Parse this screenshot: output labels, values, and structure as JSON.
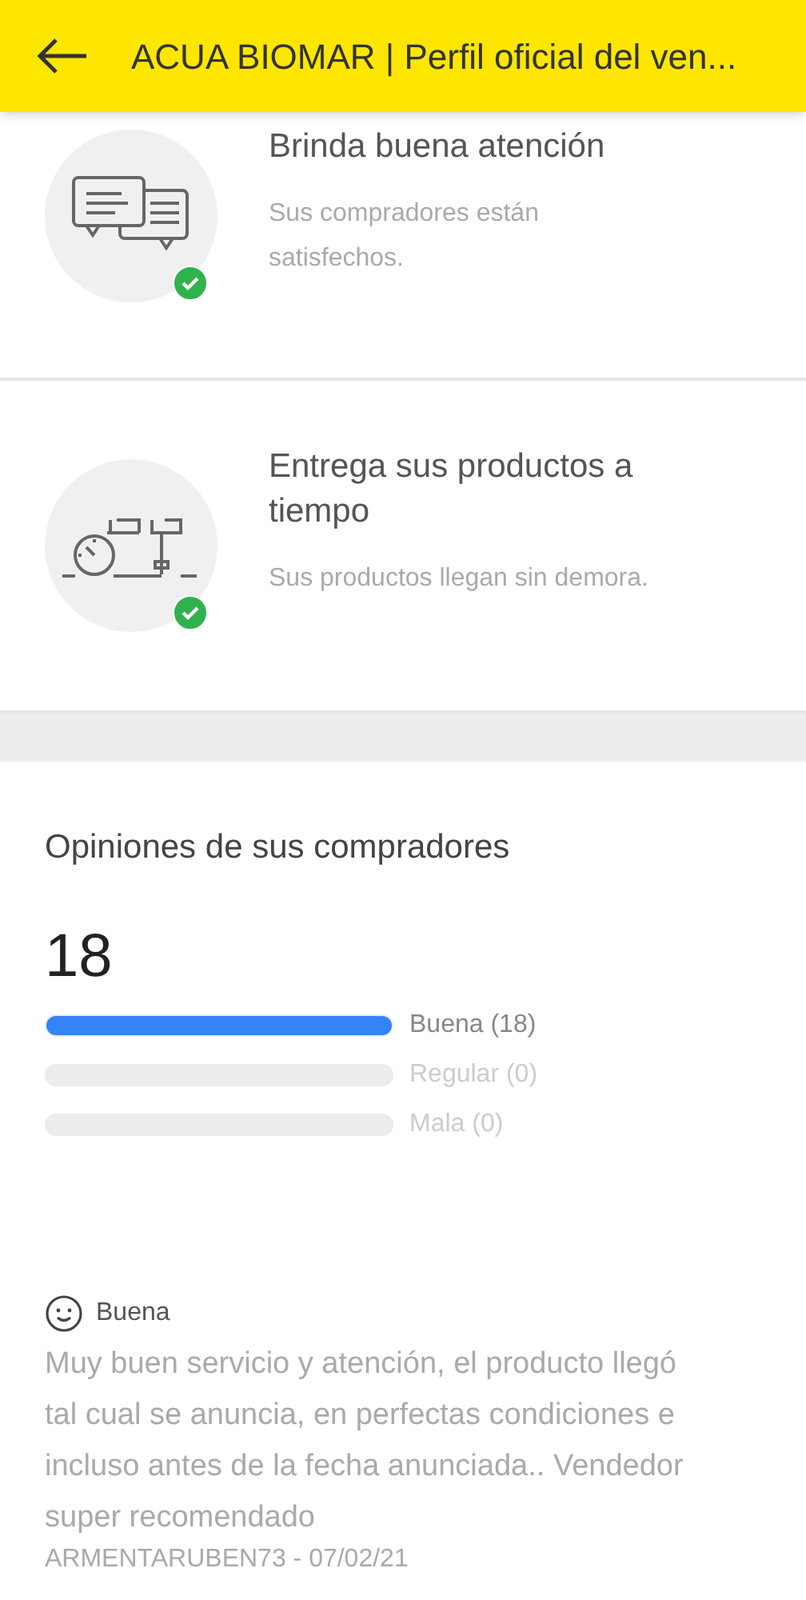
{
  "header": {
    "title": "ACUA BIOMAR | Perfil oficial del ven..."
  },
  "features": [
    {
      "kind": "attention",
      "verified": true,
      "title": "Brinda buena atención",
      "description": "Sus compradores están satisfechos."
    },
    {
      "kind": "delivery",
      "verified": true,
      "title": "Entrega sus productos a tiempo",
      "description": "Sus productos llegan sin demora."
    }
  ],
  "opinions": {
    "title": "Opiniones de sus compradores",
    "total": "18",
    "bars": [
      {
        "label": "Buena (18)",
        "level": 1
      },
      {
        "label": "Regular (0)"
      },
      {
        "label": "Mala (0)"
      }
    ]
  },
  "reviews": [
    {
      "kind": "good",
      "rating": "Buena",
      "text": "Muy buen servicio y atención, el producto llegó tal cual se anuncia, en perfectas condiciones e incluso antes de la fecha anunciada.. Vendedor super recomendado",
      "author": "ARMENTARUBEN73 - 07/02/21"
    }
  ]
}
